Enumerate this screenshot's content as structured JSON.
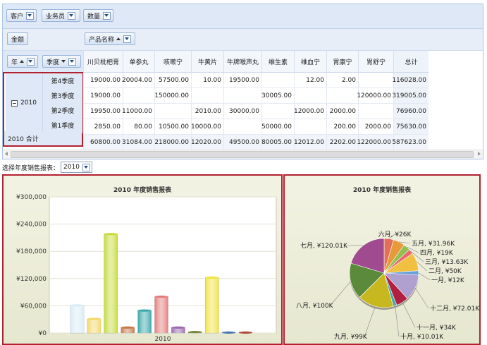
{
  "filters": [
    {
      "label": "客户"
    },
    {
      "label": "业务员"
    },
    {
      "label": "数量"
    }
  ],
  "measure_label": "金额",
  "column_field": {
    "label": "产品名称",
    "sort": "asc"
  },
  "row_fields": [
    {
      "label": "年",
      "sort": "asc"
    },
    {
      "label": "季度",
      "sort": "desc"
    }
  ],
  "columns": [
    "川贝枇杷膏",
    "单参丸",
    "咳嗽宁",
    "牛黄片",
    "牛牌喉声丸",
    "维生素",
    "维血宁",
    "胃康宁",
    "胃舒宁",
    "总计"
  ],
  "year_label": "2010",
  "year_total_label": "2010 合计",
  "rows": [
    {
      "quarter": "第4季度",
      "values": [
        "19000.00",
        "20004.00",
        "57500.00",
        "10.00",
        "19500.00",
        "",
        "12.00",
        "2.00",
        "",
        "116028.00"
      ]
    },
    {
      "quarter": "第3季度",
      "values": [
        "19000.00",
        "",
        "150000.00",
        "",
        "",
        "30005.00",
        "",
        "",
        "120000.00",
        "319005.00"
      ]
    },
    {
      "quarter": "第2季度",
      "values": [
        "19950.00",
        "11000.00",
        "",
        "2010.00",
        "30000.00",
        "",
        "12000.00",
        "2000.00",
        "",
        "76960.00"
      ]
    },
    {
      "quarter": "第1季度",
      "values": [
        "2850.00",
        "80.00",
        "10500.00",
        "10000.00",
        "",
        "50000.00",
        "",
        "200.00",
        "2000.00",
        "75630.00"
      ]
    }
  ],
  "total_row": [
    "60800.00",
    "31084.00",
    "218000.00",
    "12020.00",
    "49500.00",
    "80005.00",
    "12012.00",
    "2202.00",
    "122000.00",
    "587623.00"
  ],
  "year_select": {
    "label": "选择年度销售报表：",
    "value": "2010"
  },
  "colors": {
    "accent_border": "#b22030",
    "header_bg": "#dfe8f6"
  },
  "chart_data": [
    {
      "type": "bar",
      "title": "2010 年度销售报表",
      "categories": [
        "2010"
      ],
      "y_ticks": [
        "¥0",
        "¥60,000",
        "¥120,000",
        "¥180,000",
        "¥240,000",
        "¥300,000"
      ],
      "ylim": [
        0,
        300000
      ],
      "series": [
        {
          "values": [
            60800
          ],
          "color": "#d8ecf6"
        },
        {
          "values": [
            31084
          ],
          "color": "#f4d86a"
        },
        {
          "values": [
            218000
          ],
          "color": "#c6dc3a"
        },
        {
          "values": [
            12020
          ],
          "color": "#c8794a"
        },
        {
          "values": [
            49500
          ],
          "color": "#3aa8a8"
        },
        {
          "values": [
            80005
          ],
          "color": "#e47c7c"
        },
        {
          "values": [
            12012
          ],
          "color": "#9b6ab0"
        },
        {
          "values": [
            2202
          ],
          "color": "#7a8a3a"
        },
        {
          "values": [
            122000
          ],
          "color": "#f0e440"
        },
        {
          "values": [
            500
          ],
          "color": "#4a7ab0"
        },
        {
          "values": [
            200
          ],
          "color": "#b04a3a"
        }
      ]
    },
    {
      "type": "pie",
      "title": "2010 年度销售报表",
      "slices": [
        {
          "label": "六月, ¥26K",
          "value": 26,
          "color": "#e0705a"
        },
        {
          "label": "五月, ¥31.96K",
          "value": 31.96,
          "color": "#e89a3a"
        },
        {
          "label": "四月, ¥19K",
          "value": 19,
          "color": "#90c050"
        },
        {
          "label": "三月, ¥13.63K",
          "value": 13.63,
          "color": "#e86a6a"
        },
        {
          "label": "二月, ¥50K",
          "value": 50,
          "color": "#f0c040"
        },
        {
          "label": "一月, ¥12K",
          "value": 12,
          "color": "#6aa0d8"
        },
        {
          "label": "十二月, ¥72.01K",
          "value": 72.01,
          "color": "#b0a0d0"
        },
        {
          "label": "十一月, ¥34K",
          "value": 34,
          "color": "#b02040"
        },
        {
          "label": "十月, ¥10.01K",
          "value": 10.01,
          "color": "#50a8a8"
        },
        {
          "label": "九月, ¥99K",
          "value": 99,
          "color": "#c8b820"
        },
        {
          "label": "八月, ¥100K",
          "value": 100,
          "color": "#5a8a3a"
        },
        {
          "label": "七月, ¥120.01K",
          "value": 120.01,
          "color": "#a04a90"
        }
      ]
    }
  ]
}
